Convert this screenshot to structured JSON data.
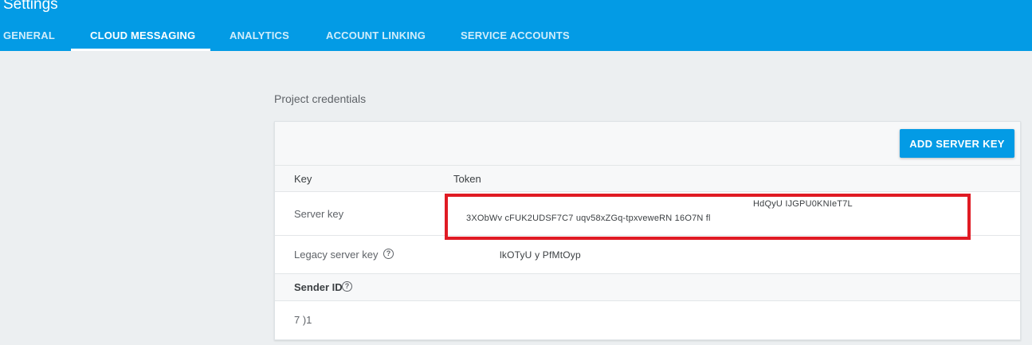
{
  "header": {
    "title": "Settings",
    "tabs": [
      {
        "label": "GENERAL"
      },
      {
        "label": "CLOUD MESSAGING"
      },
      {
        "label": "ANALYTICS"
      },
      {
        "label": "ACCOUNT LINKING"
      },
      {
        "label": "SERVICE ACCOUNTS"
      }
    ],
    "active_tab": "CLOUD MESSAGING"
  },
  "credentials": {
    "heading": "Project credentials",
    "add_button_label": "ADD SERVER KEY",
    "columns": {
      "key": "Key",
      "token": "Token"
    },
    "server_key": {
      "label": "Server key",
      "token_line1": "HdQyU IJGPU0KNIeT7L",
      "token_line2": "3XObWv   cFUK2UDSF7C7   uqv58xZGq-tpxveweRN   16O7N    fl"
    },
    "legacy_server_key": {
      "label": "Legacy server key",
      "help_glyph": "?",
      "token": "lkOTyU    y  PfMtOyp"
    },
    "sender_id": {
      "label": "Sender ID",
      "help_glyph": "?",
      "value": "7             )1"
    }
  },
  "colors": {
    "brand_blue": "#039be5",
    "highlight_red": "#e01b24",
    "page_background": "#eceff1"
  }
}
